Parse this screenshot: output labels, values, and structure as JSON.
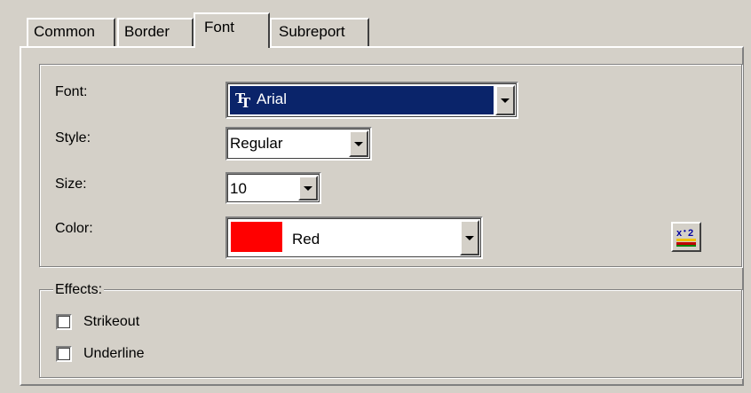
{
  "tabs": [
    {
      "label": "Common",
      "active": false
    },
    {
      "label": "Border",
      "active": false
    },
    {
      "label": "Font",
      "active": true
    },
    {
      "label": "Subreport",
      "active": false
    }
  ],
  "font_group": {
    "font_label": "Font:",
    "font_value": "Arial",
    "font_icon": "truetype-font-icon",
    "style_label": "Style:",
    "style_value": "Regular",
    "size_label": "Size:",
    "size_value": "10",
    "color_label": "Color:",
    "color_value": "Red",
    "color_swatch": "#ff0000",
    "custom_color_icon": "custom-color-icon"
  },
  "effects": {
    "caption": "Effects:",
    "strikeout_label": "Strikeout",
    "strikeout_checked": false,
    "underline_label": "Underline",
    "underline_checked": false
  },
  "colors": {
    "dialog_bg": "#d4d0c8",
    "selection": "#0a246a"
  }
}
